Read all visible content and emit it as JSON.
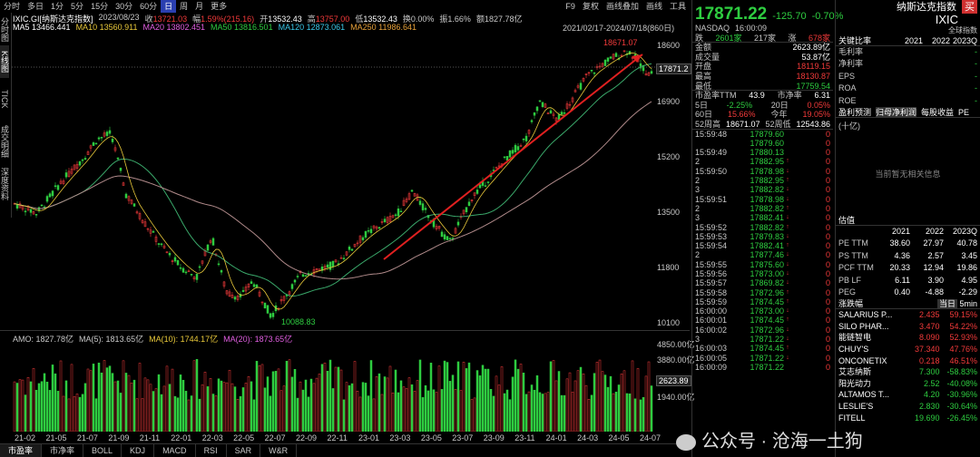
{
  "toolbar": {
    "periods": [
      "分时",
      "多日",
      "1分",
      "5分",
      "15分",
      "30分",
      "60分",
      "日",
      "周",
      "月",
      "更多"
    ],
    "active": "日",
    "right": [
      "F9",
      "复权",
      "画线叠加",
      "画线",
      "工具"
    ]
  },
  "left_strip": [
    "分时图",
    "K线图",
    "TICK",
    "成交明细",
    "深度资料"
  ],
  "info": {
    "code": "IXIC.GI[纳斯达克指数]",
    "date": "2023/08/23",
    "close_label": "收",
    "close": "13721.03",
    "change_label": "幅",
    "change": "1.59%(215.16)",
    "open_label": "开",
    "open": "13532.43",
    "high_label": "高",
    "high": "13757.00",
    "low_label": "低",
    "low": "13532.43",
    "turnover": "换0.00%",
    "amp": "振1.66%",
    "amt": "额1827.78亿"
  },
  "ma": {
    "ma5": "MA5 13466.441",
    "ma10": "MA10 13560.911",
    "ma20": "MA20 13802.451",
    "ma50": "MA50 13816.501",
    "ma120": "MA120 12873.061",
    "ma250": "MA250 11986.641"
  },
  "range": "2021/02/17-2024/07/18(860日)",
  "yaxis": [
    "18600",
    "16900",
    "15200",
    "13500",
    "11800",
    "10100"
  ],
  "price_marker": "17871.2",
  "high_mark": "18671.07",
  "low_mark": "10088.83",
  "amo": {
    "label": "AMO: 1827.78亿",
    "ma5": "MA(5): 1813.65亿",
    "ma10": "MA(10): 1744.17亿",
    "ma20": "MA(20): 1873.65亿"
  },
  "vol_axis": [
    "4850.00亿",
    "3880.00亿",
    "2623.89",
    "1940.00亿"
  ],
  "xaxis": [
    "21-02",
    "21-05",
    "21-07",
    "21-09",
    "21-11",
    "22-01",
    "22-03",
    "22-05",
    "22-07",
    "22-09",
    "22-11",
    "23-01",
    "23-03",
    "23-05",
    "23-07",
    "23-09",
    "23-11",
    "24-01",
    "24-03",
    "24-05",
    "24-07"
  ],
  "bottom_tabs": [
    "市盈率",
    "市净率",
    "BOLL",
    "KDJ",
    "MACD",
    "RSI",
    "SAR",
    "W&R"
  ],
  "quote": {
    "price": "17871.22",
    "chg": "-125.70",
    "pct": "-0.70%",
    "name": "纳斯达克指数",
    "sym": "IXIC",
    "buy": "买",
    "market": "NASDAQ",
    "time": "16:00:09",
    "global": "全球指数"
  },
  "stats": [
    [
      "跌",
      "2601家",
      "217家",
      "涨",
      "678家"
    ]
  ],
  "stat_rows": [
    [
      "金额",
      "2623.89亿"
    ],
    [
      "成交量",
      "53.87亿"
    ],
    [
      "开盘",
      "18119.15"
    ],
    [
      "最高",
      "18130.87"
    ],
    [
      "最低",
      "17759.54"
    ]
  ],
  "stat2": [
    [
      "市盈率TTM",
      "43.9",
      "市净率",
      "6.31"
    ],
    [
      "5日",
      "-2.25%",
      "20日",
      "0.05%"
    ],
    [
      "60日",
      "15.66%",
      "今年",
      "19.05%"
    ],
    [
      "52周高",
      "18671.07",
      "52周低",
      "12543.86"
    ]
  ],
  "ticks": [
    [
      "15:59:48",
      "17879.60",
      "0",
      ""
    ],
    [
      "",
      "17879.60",
      "0",
      ""
    ],
    [
      "15:59:49",
      "17880.13",
      "0",
      ""
    ],
    [
      "2",
      "17882.95",
      "0",
      "↑"
    ],
    [
      "15:59:50",
      "17878.98",
      "0",
      "↓"
    ],
    [
      "2",
      "17882.95",
      "0",
      "↑"
    ],
    [
      "3",
      "17882.82",
      "0",
      "↓"
    ],
    [
      "15:59:51",
      "17878.98",
      "0",
      "↓"
    ],
    [
      "2",
      "17882.82",
      "0",
      "↑"
    ],
    [
      "3",
      "17882.41",
      "0",
      "↓"
    ],
    [
      "15:59:52",
      "17882.82",
      "0",
      "↑"
    ],
    [
      "15:59:53",
      "17879.83",
      "0",
      "↓"
    ],
    [
      "15:59:54",
      "17882.41",
      "0",
      "↑"
    ],
    [
      "2",
      "17877.46",
      "0",
      "↓"
    ],
    [
      "15:59:55",
      "17875.60",
      "0",
      "↓"
    ],
    [
      "15:59:56",
      "17873.00",
      "0",
      "↓"
    ],
    [
      "15:59:57",
      "17869.82",
      "0",
      "↓"
    ],
    [
      "15:59:58",
      "17872.96",
      "0",
      "↑"
    ],
    [
      "15:59:59",
      "17874.45",
      "0",
      "↑"
    ],
    [
      "16:00:00",
      "17873.00",
      "0",
      "↓"
    ],
    [
      "16:00:01",
      "17874.45",
      "0",
      "↑"
    ],
    [
      "16:00:02",
      "17872.96",
      "0",
      "↓"
    ],
    [
      "3",
      "17871.22",
      "0",
      "↓"
    ],
    [
      "16:00:03",
      "17874.45",
      "0",
      "↑"
    ],
    [
      "16:00:05",
      "17871.22",
      "0",
      "↓"
    ],
    [
      "16:00:09",
      "17871.22",
      "0",
      ""
    ]
  ],
  "fin": {
    "title": "关键比率",
    "years": [
      "2021",
      "2022",
      "2023Q"
    ],
    "rows": [
      "毛利率",
      "净利率",
      "EPS",
      "ROA",
      "ROE"
    ]
  },
  "forecast": {
    "title": "盈利预测",
    "tabs": [
      "归母净利润",
      "每股收益",
      "PE"
    ],
    "unit": "(十亿)",
    "empty": "当前暂无相关信息"
  },
  "valuation": {
    "title": "估值",
    "years": [
      "2021",
      "2022",
      "2023Q"
    ],
    "rows": [
      [
        "PE TTM",
        "38.60",
        "27.97",
        "40.78"
      ],
      [
        "PS TTM",
        "4.36",
        "2.57",
        "3.45"
      ],
      [
        "PCF TTM",
        "20.33",
        "12.94",
        "19.86"
      ],
      [
        "PB LF",
        "6.11",
        "3.90",
        "4.95"
      ],
      [
        "PEG",
        "0.40",
        "-4.88",
        "-2.29"
      ]
    ]
  },
  "movers": {
    "title": "涨跌幅",
    "tabs": [
      "当日",
      "5min"
    ],
    "up": [
      [
        "SALARIUS P...",
        "2.435",
        "59.15%"
      ],
      [
        "SILO PHAR...",
        "3.470",
        "54.22%"
      ],
      [
        "能链智电",
        "8.090",
        "52.93%"
      ],
      [
        "CHUY'S",
        "37.340",
        "47.76%"
      ],
      [
        "ONCONETIX",
        "0.218",
        "46.51%"
      ]
    ],
    "down": [
      [
        "艾志纳斯",
        "7.300",
        "-58.83%"
      ],
      [
        "阳光动力",
        "2.52",
        "-40.08%"
      ],
      [
        "ALTAMOS T...",
        "4.20",
        "-30.96%"
      ],
      [
        "LESLIE'S",
        "2.830",
        "-30.64%"
      ],
      [
        "FITELL",
        "19.690",
        "-26.45%"
      ]
    ]
  },
  "watermark": "公众号 · 沧海一土狗",
  "colors": {
    "up": "#f23a3a",
    "down": "#2ecc40",
    "bg": "#000000",
    "ma_yellow": "#e8c83a",
    "arrow": "#e02020"
  }
}
